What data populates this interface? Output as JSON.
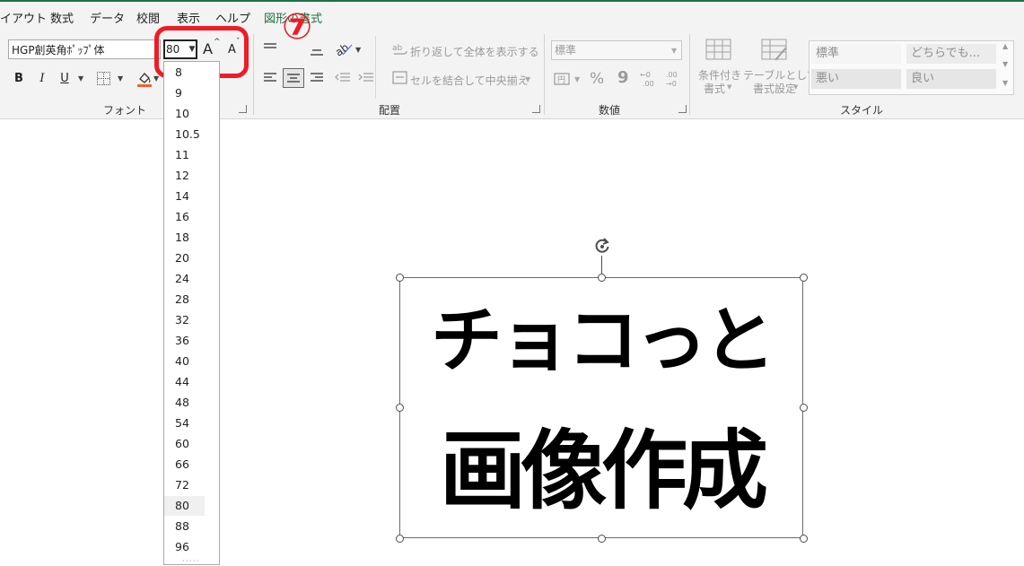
{
  "menu": {
    "tabs": [
      "イアウト",
      "数式",
      "データ",
      "校閲",
      "表示",
      "ヘルプ",
      "図形の書式"
    ]
  },
  "font": {
    "name": "HGP創英角ﾎﾟｯﾌﾟ体",
    "size": "80",
    "grow_label": "A",
    "shrink_label": "A",
    "bold": "B",
    "italic": "I",
    "underline": "U",
    "group_label": "フォント"
  },
  "alignment": {
    "wrap_text": "折り返して全体を表示する",
    "merge_center": "セルを結合して中央揃え",
    "group_label": "配置"
  },
  "number": {
    "format": "標準",
    "percent": "%",
    "comma": "9",
    "group_label": "数値"
  },
  "styles": {
    "conditional": [
      "条件付き",
      "書式"
    ],
    "as_table": [
      "テーブルとして",
      "書式設定"
    ],
    "cells": [
      "標準",
      "どちらでも...",
      "悪い",
      "良い"
    ],
    "group_label": "スタイル"
  },
  "annotation": {
    "number": "⑦"
  },
  "font_size_dropdown": {
    "options": [
      "8",
      "9",
      "10",
      "10.5",
      "11",
      "12",
      "14",
      "16",
      "18",
      "20",
      "24",
      "28",
      "32",
      "36",
      "40",
      "44",
      "48",
      "54",
      "60",
      "66",
      "72",
      "80",
      "88",
      "96"
    ],
    "selected": "80"
  },
  "shape": {
    "line1": "チョコっと",
    "line2": "画像作成"
  },
  "colors": {
    "accent_green": "#1e7145",
    "annotation_red": "#ee1c25",
    "fill_color_bar": "#f2622e"
  }
}
